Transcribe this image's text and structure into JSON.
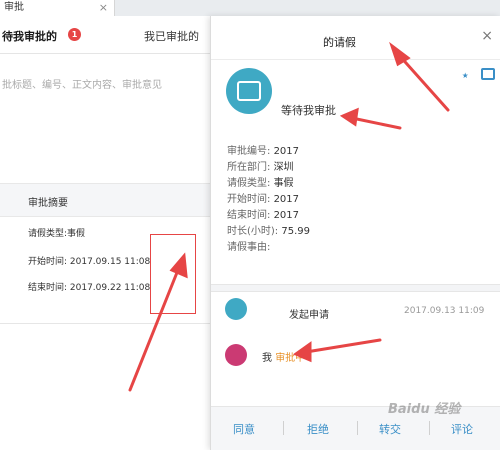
{
  "window_tab": {
    "title": "审批",
    "close": "×"
  },
  "left": {
    "tabs": [
      {
        "label": "待我审批的",
        "badge": "1"
      },
      {
        "label": "我已审批的"
      }
    ],
    "search_placeholder": "批标题、编号、正文内容、审批意见",
    "summary_header": "审批摘要",
    "rows": [
      "请假类型:事假",
      "开始时间: 2017.09.15 11:08",
      "结束时间: 2017.09.22 11:08"
    ]
  },
  "detail": {
    "title": "的请假",
    "close": "×",
    "status": "等待我审批",
    "fields": [
      {
        "label": "审批编号:",
        "value": "2017"
      },
      {
        "label": "所在部门:",
        "value": "深圳"
      },
      {
        "label": "请假类型:",
        "value": "事假"
      },
      {
        "label": "开始时间:",
        "value": "2017"
      },
      {
        "label": "结束时间:",
        "value": "2017"
      },
      {
        "label": "时长(小时):",
        "value": "75.99"
      },
      {
        "label": "请假事由:",
        "value": ""
      }
    ],
    "flow": [
      {
        "text": "发起申请",
        "date": "2017.09.13 11:09"
      },
      {
        "text": "我",
        "pending": "审批中"
      }
    ],
    "actions": [
      "同意",
      "拒绝",
      "转交",
      "评论"
    ]
  },
  "watermark": "Baidu 经验",
  "colors": {
    "accent": "#3a8fc7",
    "badge": "#e64545",
    "arrow": "#e64545",
    "pending": "#e8922a"
  }
}
